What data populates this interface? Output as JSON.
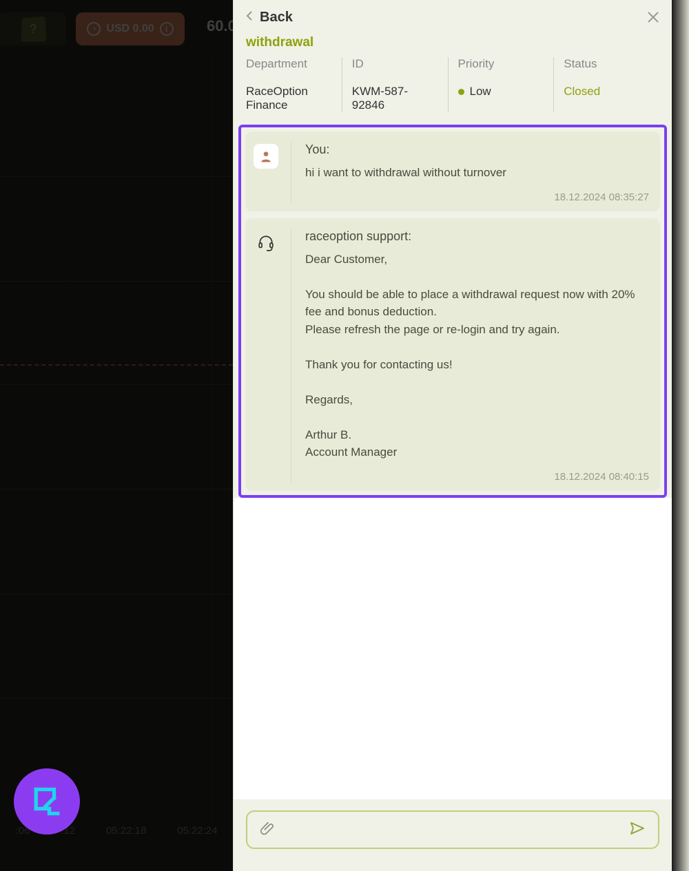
{
  "background": {
    "usd_label": "USD 0.00",
    "number": "60.0",
    "time_labels": [
      ":06",
      ":12",
      "05:22:18",
      "05:22:24"
    ]
  },
  "header": {
    "back_label": "Back"
  },
  "ticket": {
    "title": "withdrawal",
    "meta": {
      "department_label": "Department",
      "department_value": "RaceOption Finance",
      "id_label": "ID",
      "id_value": "KWM-587-92846",
      "priority_label": "Priority",
      "priority_value": "Low",
      "status_label": "Status",
      "status_value": "Closed"
    }
  },
  "messages": [
    {
      "sender": "You:",
      "body": "hi i want to withdrawal without turnover",
      "time": "18.12.2024 08:35:27",
      "type": "user"
    },
    {
      "sender": "raceoption support:",
      "body": "Dear Customer,\n\nYou should be able to place a withdrawal request now with 20% fee and bonus deduction.\nPlease refresh the page or re-login and try again.\n\nThank you for contacting us!\n\nRegards,\n\nArthur B.\nAccount Manager",
      "time": "18.12.2024 08:40:15",
      "type": "support"
    }
  ],
  "input": {
    "placeholder": ""
  }
}
